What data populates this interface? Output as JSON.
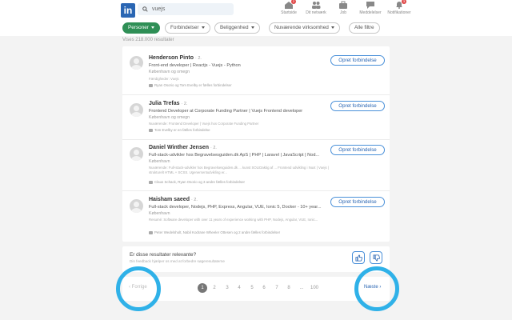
{
  "nav": {
    "logo": "in",
    "search_value": "vuejs",
    "items": [
      {
        "label": "Startside",
        "icon": "home-icon",
        "badge": "2"
      },
      {
        "label": "Dit netværk",
        "icon": "network-icon",
        "badge": ""
      },
      {
        "label": "Job",
        "icon": "briefcase-icon",
        "badge": ""
      },
      {
        "label": "Meddelelser",
        "icon": "messages-icon",
        "badge": ""
      },
      {
        "label": "Notifikationer",
        "icon": "bell-icon",
        "badge": "3"
      }
    ]
  },
  "filters": {
    "personer": "Personer",
    "forbindelser": "Forbindelser",
    "beliggenhed": "Beliggenhed",
    "virksomhed": "Nuværende virksomhed",
    "alle": "Alle filtre"
  },
  "results_count": "Vises 218.000 resultater",
  "connect_label": "Opret forbindelse",
  "results": [
    {
      "name": "Henderson Pinto",
      "degree": "· 2.",
      "headline": "Front-end developer | Reactjs - Vuejs - Python",
      "location": "København og omegn",
      "snippet": "Færdigheder: Vuejs",
      "mutual": "Ryan Osorio og Tom Evelby er fælles forbindelser"
    },
    {
      "name": "Julia Trefas",
      "degree": "· 2.",
      "headline": "Frontend Developer at Corporate Funding Partner | Vuejs Frontend developer",
      "location": "København og omegn",
      "snippet": "Nuværende: Frontend Developer | Vuejs hos Corporate Funding Partner",
      "mutual": "Tom Evelby er en fælles forbindelse"
    },
    {
      "name": "Daniel Winther Jensen",
      "degree": "· 2.",
      "headline": "Full-stack-udvikler hos Begravelsesguiden.dk ApS | PHP | Laravel | JavaScript | Nod...",
      "location": "København",
      "snippet": "Nuværende: Full-stack-udvikler hos Begravelsesguiden.dk ... kunst SOLIDaktig af ... Frontend udvikling i Nuxt | Vuejs | strukturelt HTML + SCSS. Ugenersentudvikling er...",
      "mutual": "Claus Schack, Ryan Osorio og 3 andre fælles forbindelser"
    },
    {
      "name": "Haisham saeed",
      "degree": "· 2.",
      "headline": "Full-stack developer, Nodejs, PHP, Express, Angular, VUE, Ionic 5, Docker - 10+ year...",
      "location": "København",
      "snippet": "Resumé: Software developer with over 11 years of experience working with PHP, Nodejs, Angular, VUE, Ionic...",
      "mutual": "Peter Wedelsholt, Nabil Kodrane Wheeler Ottesen og 2 andre fælles forbindelser"
    }
  ],
  "feedback": {
    "question": "Er disse resultater relevante?",
    "sub": "Din feedback hjælper os med at forbedre søgeresultaterne"
  },
  "pagination": {
    "prev": "‹ Forrige",
    "next": "Næste ›",
    "pages": [
      "1",
      "2",
      "3",
      "4",
      "5",
      "6",
      "7",
      "8",
      "...",
      "100"
    ],
    "active": "1"
  },
  "colors": {
    "brand": "#2a66b3",
    "active_filter": "#2f8f56",
    "highlight": "#2fb1e8"
  }
}
